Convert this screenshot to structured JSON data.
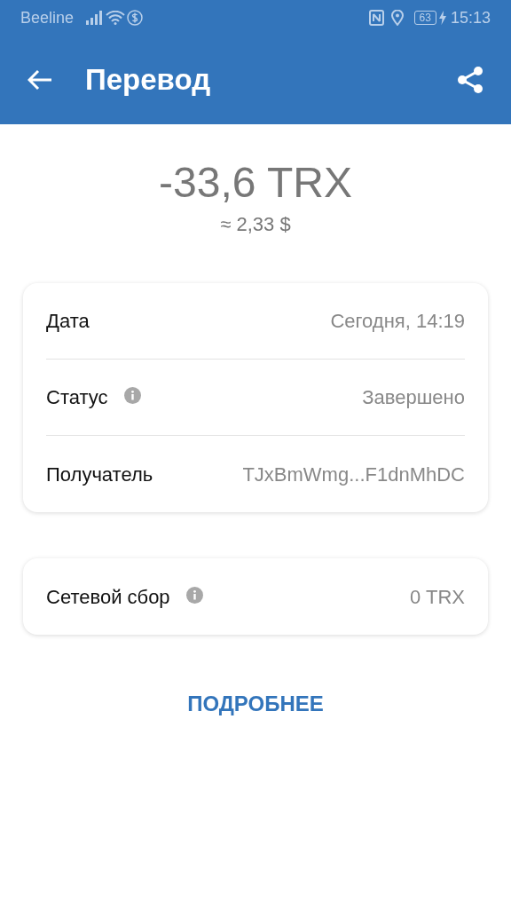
{
  "status_bar": {
    "carrier": "Beeline",
    "battery": "63",
    "time": "15:13"
  },
  "app_bar": {
    "title": "Перевод"
  },
  "amount": {
    "value": "-33,6 TRX",
    "fiat": "≈ 2,33 $"
  },
  "details": [
    {
      "label": "Дата",
      "value": "Сегодня, 14:19",
      "info": false
    },
    {
      "label": "Статус",
      "value": "Завершено",
      "info": true
    },
    {
      "label": "Получатель",
      "value": "TJxBmWmg...F1dnMhDC",
      "info": false
    }
  ],
  "fee": [
    {
      "label": "Сетевой сбор",
      "value": "0 TRX",
      "info": true
    }
  ],
  "more_button": "ПОДРОБНЕЕ"
}
